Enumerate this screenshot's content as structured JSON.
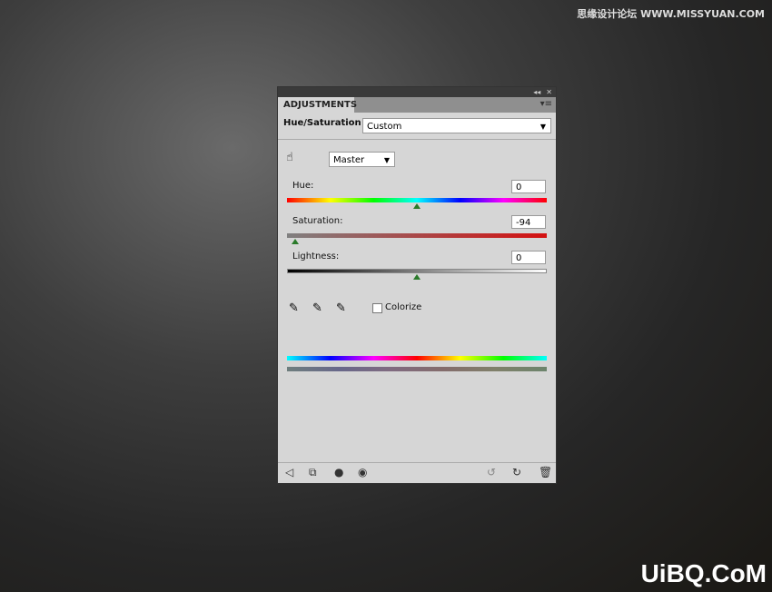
{
  "watermark": "思缘设计论坛 WWW.MISSYUAN.COM",
  "logo": "UiBQ.CoM",
  "panel": {
    "tab": "ADJUSTMENTS",
    "title": "Hue/Saturation",
    "preset": "Custom",
    "channel": "Master",
    "hue": {
      "label": "Hue:",
      "value": "0",
      "position": 0.5
    },
    "saturation": {
      "label": "Saturation:",
      "value": "-94",
      "position": 0.03
    },
    "lightness": {
      "label": "Lightness:",
      "value": "0",
      "position": 0.5
    },
    "colorize": {
      "label": "Colorize",
      "checked": false
    }
  }
}
